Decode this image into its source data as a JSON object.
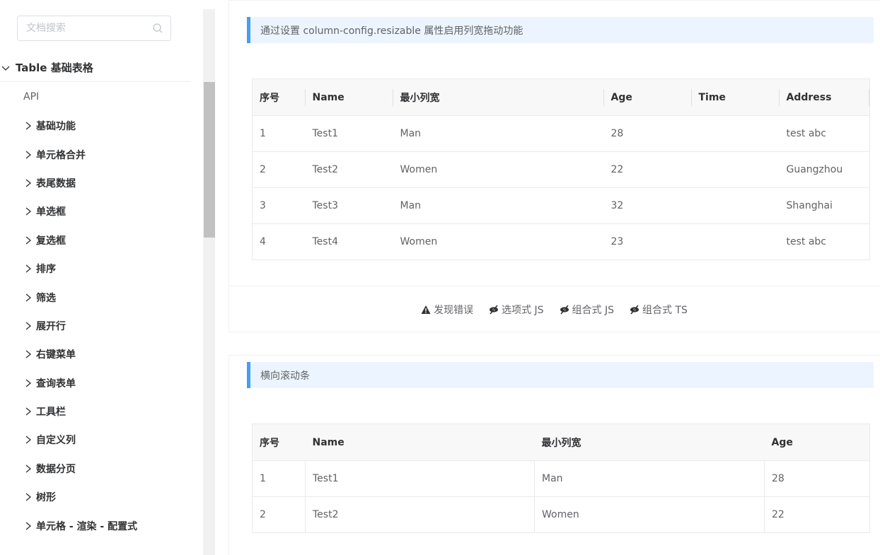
{
  "sidebar": {
    "search_placeholder": "文档搜索",
    "group_label": "Table 基础表格",
    "api_label": "API",
    "items": [
      {
        "label": "基础功能"
      },
      {
        "label": "单元格合并"
      },
      {
        "label": "表尾数据"
      },
      {
        "label": "单选框"
      },
      {
        "label": "复选框"
      },
      {
        "label": "排序"
      },
      {
        "label": "筛选"
      },
      {
        "label": "展开行"
      },
      {
        "label": "右键菜单"
      },
      {
        "label": "查询表单"
      },
      {
        "label": "工具栏"
      },
      {
        "label": "自定义列"
      },
      {
        "label": "数据分页"
      },
      {
        "label": "树形"
      },
      {
        "label": "单元格 - 渲染 - 配置式"
      }
    ]
  },
  "demo1": {
    "tip": "通过设置 column-config.resizable 属性启用列宽拖动功能",
    "headers": [
      "序号",
      "Name",
      "最小列宽",
      "Age",
      "Time",
      "Address"
    ],
    "rows": [
      [
        "1",
        "Test1",
        "Man",
        "28",
        "",
        "test abc"
      ],
      [
        "2",
        "Test2",
        "Women",
        "22",
        "",
        "Guangzhou"
      ],
      [
        "3",
        "Test3",
        "Man",
        "32",
        "",
        "Shanghai"
      ],
      [
        "4",
        "Test4",
        "Women",
        "23",
        "",
        "test abc"
      ]
    ],
    "actions": {
      "report": "发现错误",
      "options_js": "选项式 JS",
      "composition_js": "组合式 JS",
      "composition_ts": "组合式 TS"
    }
  },
  "demo2": {
    "tip": "横向滚动条",
    "headers": [
      "序号",
      "Name",
      "最小列宽",
      "Age"
    ],
    "rows": [
      [
        "1",
        "Test1",
        "Man",
        "28"
      ],
      [
        "2",
        "Test2",
        "Women",
        "22"
      ]
    ]
  },
  "colors": {
    "accent": "#409eff",
    "tip_bg": "#ecf5ff",
    "header_bg": "#f8f8f9"
  }
}
